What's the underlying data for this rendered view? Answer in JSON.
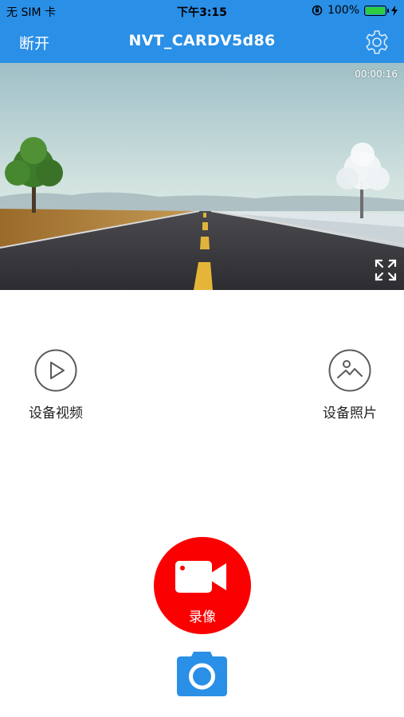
{
  "status_bar": {
    "carrier": "无 SIM 卡",
    "time": "下午3:15",
    "battery": "100%",
    "battery_level": 1.0
  },
  "nav": {
    "left_label": "断开",
    "title": "NVT_CARDV5d86",
    "settings_icon": "gear-icon"
  },
  "video": {
    "timer": "00:00:16",
    "fullscreen_icon": "expand-arrows-icon"
  },
  "actions": {
    "videos_label": "设备视频",
    "videos_icon": "play-circle-icon",
    "photos_label": "设备照片",
    "photos_icon": "image-circle-icon"
  },
  "record": {
    "label": "录像",
    "icon": "video-camera-icon",
    "color": "#fb0000"
  },
  "photo_button": {
    "icon": "camera-icon",
    "color": "#2a8fe6"
  },
  "colors": {
    "accent": "#2a8fe6"
  }
}
